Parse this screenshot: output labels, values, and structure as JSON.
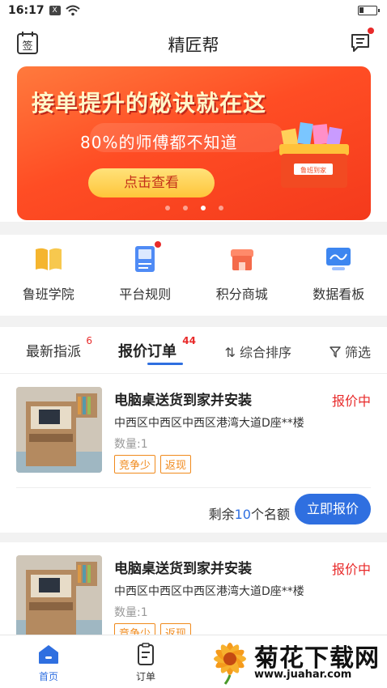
{
  "status": {
    "time": "16:17",
    "x_badge": "X"
  },
  "nav": {
    "title": "精匠帮",
    "left_icon": "sign-in-icon",
    "right_icon": "message-icon"
  },
  "banner": {
    "title": "接单提升的秘诀就在这",
    "subtitle": "80%的师傅都不知道",
    "button": "点击查看",
    "chest_label": "鲁班到家",
    "active_dot": 3,
    "dot_count": 4
  },
  "quick": [
    {
      "label": "鲁班学院",
      "icon": "book-icon",
      "color": "#f5b52e",
      "badge": false
    },
    {
      "label": "平台规则",
      "icon": "rules-icon",
      "color": "#4f8bf5",
      "badge": true
    },
    {
      "label": "积分商城",
      "icon": "store-icon",
      "color": "#f46a4a",
      "badge": false
    },
    {
      "label": "数据看板",
      "icon": "dashboard-icon",
      "color": "#3d86f0",
      "badge": false
    }
  ],
  "tabs": {
    "latest": {
      "label": "最新指派",
      "count": "6"
    },
    "quote": {
      "label": "报价订单",
      "count": "44"
    },
    "sort": "综合排序",
    "filter": "筛选"
  },
  "orders": [
    {
      "title": "电脑桌送货到家并安装",
      "status": "报价中",
      "address": "中西区中西区中西区港湾大道D座**楼",
      "qty": "数量:1",
      "tags": [
        "竞争少",
        "返现"
      ],
      "remain_prefix": "剩余",
      "remain_num": "10",
      "remain_suffix": "个名额",
      "button": "立即报价"
    },
    {
      "title": "电脑桌送货到家并安装",
      "status": "报价中",
      "address": "中西区中西区中西区港湾大道D座**楼",
      "qty": "数量:1",
      "tags": [
        "竞争少",
        "返现"
      ]
    }
  ],
  "tabbar": [
    {
      "label": "首页",
      "icon": "home-icon",
      "active": true
    },
    {
      "label": "订单",
      "icon": "order-icon",
      "active": false
    }
  ],
  "watermark": {
    "text": "菊花下载网",
    "url": "www.juahar.com"
  },
  "colors": {
    "primary": "#2f6fe0",
    "danger": "#e82a2a",
    "tag": "#f08a1c",
    "banner": "#ff4d24"
  }
}
